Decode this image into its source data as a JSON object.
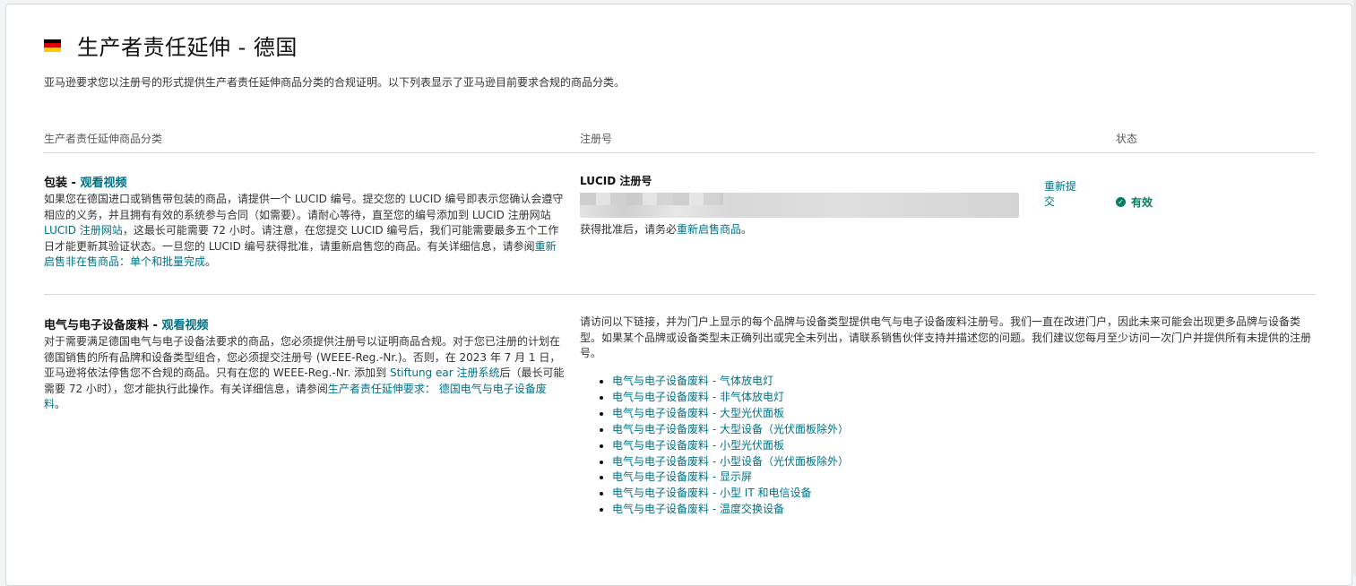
{
  "header": {
    "title": "生产者责任延伸 - 德国",
    "flag_colors": [
      "#000000",
      "#dd0000",
      "#ffce00"
    ],
    "intro": "亚马逊要求您以注册号的形式提供生产者责任延伸商品分类的合规证明。以下列表显示了亚马逊目前要求合规的商品分类。"
  },
  "table": {
    "columns": [
      "生产者责任延伸商品分类",
      "注册号",
      "状态"
    ]
  },
  "packaging": {
    "name": "包装",
    "sep": " - ",
    "video_link": "观看视频",
    "desc_1": "如果您在德国进口或销售带包装的商品，请提供一个 LUCID 编号。提交您的 LUCID 编号即表示您确认会遵守相应的义务，并且拥有有效的系统参与合同（如需要）。请耐心等待，直至您的编号添加到 LUCID 注册网站 ",
    "desc_link_1": "LUCID 注册网站",
    "desc_2": "，这最长可能需要 72 小时。请注意，在您提交 LUCID 编号后，我们可能需要最多五个工作日才能更新其验证状态。一旦您的 LUCID 编号获得批准，请重新启售您的商品。有关详细信息，请参阅",
    "desc_link_2": "重新启售非在售商品：单个和批量完成",
    "desc_3": "。",
    "reg_label": "LUCID 注册号",
    "approval_text": "获得批准后，请务必",
    "approval_link": "重新启售商品",
    "approval_end": "。",
    "resubmit": "重新提交",
    "status": "有效",
    "status_color": "#067d62"
  },
  "weee": {
    "name": "电气与电子设备废料",
    "sep": " - ",
    "video_link": "观看视频",
    "desc_1": "对于需要满足德国电气与电子设备法要求的商品，您必须提供注册号以证明商品合规。对于您已注册的计划在德国销售的所有品牌和设备类型组合，您必须提交注册号 (WEEE-Reg.-Nr.)。否则，在 2023 年 7 月 1 日，亚马逊将依法停售您不合规的商品。只有在您的 WEEE-Reg.-Nr. 添加到 ",
    "desc_link_1": "Stiftung ear 注册系统",
    "desc_2": "后（最长可能需要 72 小时），您才能执行此操作。有关详细信息，请参阅",
    "desc_link_2": "生产者责任延伸要求： 德国电气与电子设备废料",
    "desc_3": "。",
    "portal_text": "请访问以下链接，并为门户上显示的每个品牌与设备类型提供电气与电子设备废料注册号。我们一直在改进门户，因此未来可能会出现更多品牌与设备类型。如果某个品牌或设备类型未正确列出或完全未列出，请联系销售伙伴支持并描述您的问题。我们建议您每月至少访问一次门户并提供所有未提供的注册号。",
    "links": [
      "电气与电子设备废料 - 气体放电灯",
      "电气与电子设备废料 - 非气体放电灯",
      "电气与电子设备废料 - 大型光伏面板",
      "电气与电子设备废料 - 大型设备（光伏面板除外）",
      "电气与电子设备废料 - 小型光伏面板",
      "电气与电子设备废料 - 小型设备（光伏面板除外）",
      "电气与电子设备废料 - 显示屏",
      "电气与电子设备废料 - 小型 IT 和电信设备",
      "电气与电子设备废料 - 温度交换设备"
    ]
  },
  "colors": {
    "link": "#007185",
    "text": "#0f1111",
    "divider": "#d5d9d9"
  }
}
